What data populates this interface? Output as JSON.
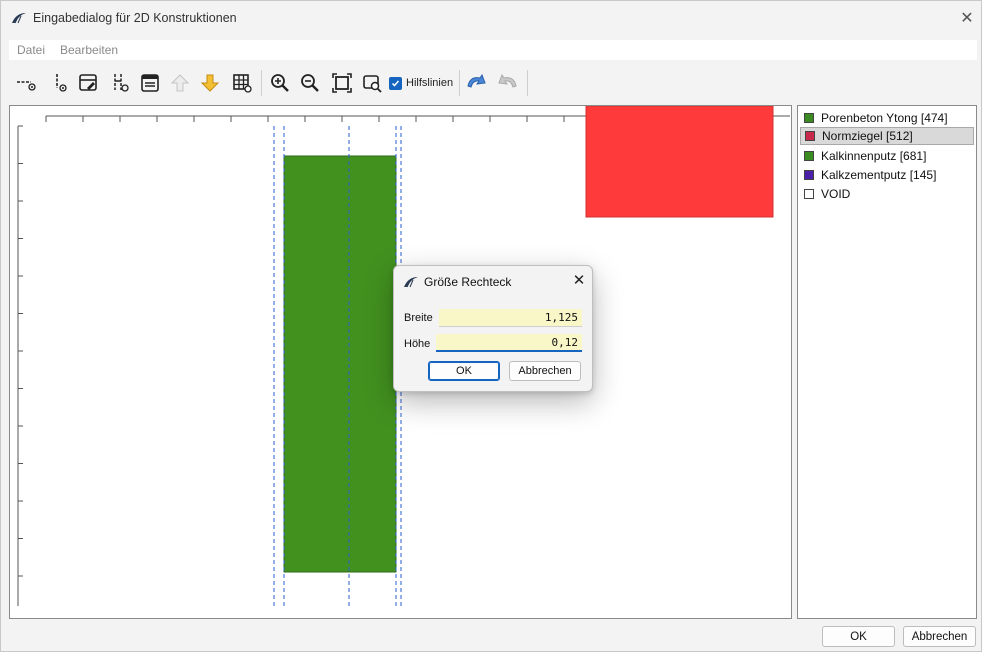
{
  "window": {
    "title": "Eingabedialog für 2D Konstruktionen"
  },
  "menu": [
    {
      "label": "Datei"
    },
    {
      "label": "Bearbeiten"
    }
  ],
  "toolbar": {
    "icons": [
      "horizontal-line-add-icon",
      "vertical-line-add-icon",
      "edit-layer-icon",
      "split-layer-icon",
      "material-table-icon",
      "move-up-icon",
      "move-down-icon",
      "grid-settings-icon",
      "zoom-in-icon",
      "zoom-out-icon",
      "zoom-fit-icon",
      "zoom-window-icon",
      "undo-icon",
      "redo-icon"
    ],
    "hilfslinien_label": "Hilfslinien",
    "hilfslinien_checked": true
  },
  "legend": [
    {
      "label": "Porenbeton Ytong [474]",
      "color": "#3a8c22",
      "selected": false
    },
    {
      "label": "Normziegel [512]",
      "color": "#c8284a",
      "selected": true
    },
    {
      "label": "Kalkinnenputz [681]",
      "color": "#3a8c22",
      "selected": false
    },
    {
      "label": "Kalkzementputz [145]",
      "color": "#4b1fa8",
      "selected": false
    },
    {
      "label": "VOID",
      "color": "#ffffff",
      "selected": false
    }
  ],
  "canvas": {
    "green_rect_color": "#42911f",
    "red_rect_color": "#ff3a3a",
    "guide_line_color": "#2a5fd0"
  },
  "dialog": {
    "title": "Größe Rechteck",
    "breite_label": "Breite",
    "breite_value": "1,125",
    "hoehe_label": "Höhe",
    "hoehe_value": "0,12",
    "ok_label": "OK",
    "cancel_label": "Abbrechen"
  },
  "footer": {
    "ok_label": "OK",
    "cancel_label": "Abbrechen"
  }
}
